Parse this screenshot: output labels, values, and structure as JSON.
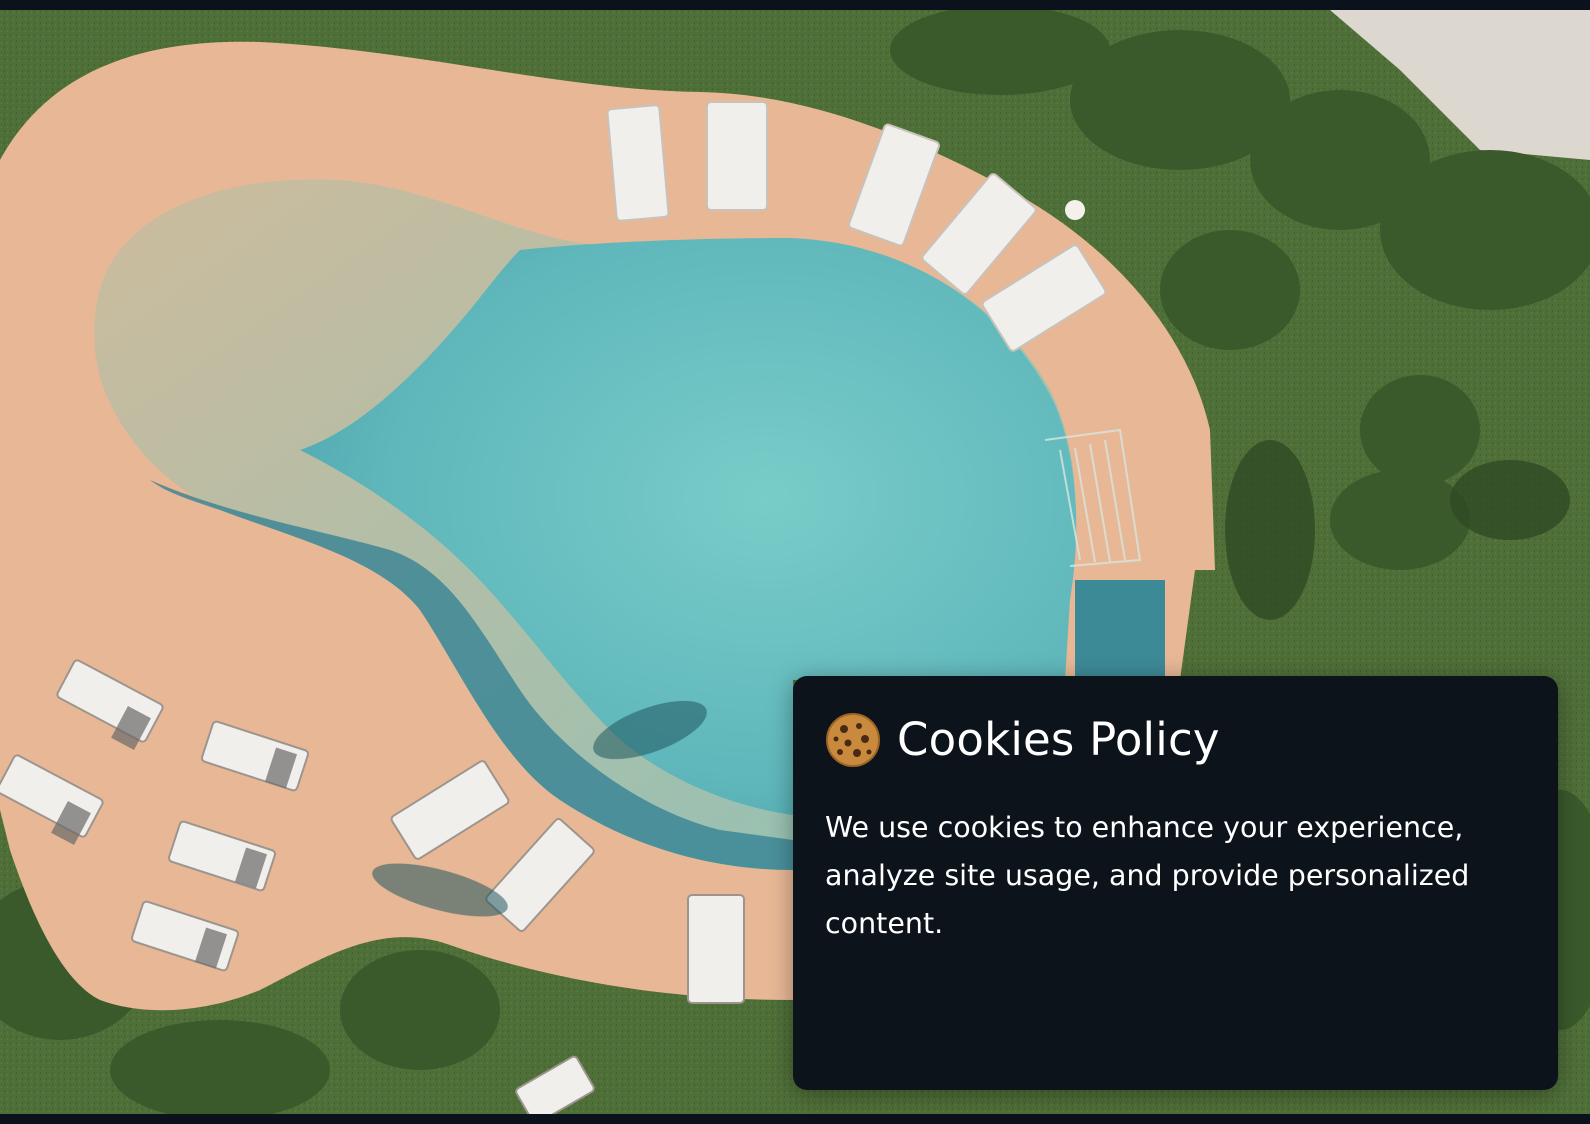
{
  "hero": {
    "image_subject": "aerial view of a resort pool with sun loungers"
  },
  "cookie_banner": {
    "icon": "cookie-icon",
    "title": "Cookies Policy",
    "message": "We use cookies to enhance your experience, analyze site usage, and provide personalized content."
  },
  "colors": {
    "page_background": "#0c121b",
    "card_background": "#0d131b",
    "card_text": "#ffffff",
    "grass": "#4f6f38",
    "deck": "#e8b896",
    "water": "#5fb7bb",
    "water_deep": "#2f7f93"
  }
}
